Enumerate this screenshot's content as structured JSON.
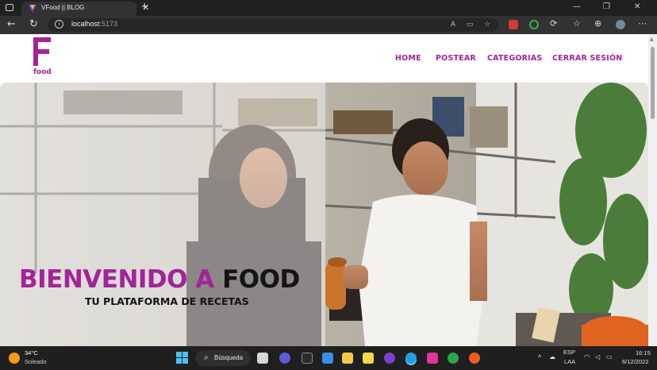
{
  "browser": {
    "tab_title": "VFood || BLOG",
    "close_label": "✕",
    "new_tab_label": "+",
    "address_host": "localhost",
    "address_port": ":5173",
    "window_controls": {
      "minimize": "—",
      "maximize": "❐",
      "close": "✕"
    },
    "reader_label": "A",
    "icons": [
      "back-icon",
      "refresh-icon",
      "info-icon",
      "read-aloud-icon",
      "immersive-reader-icon",
      "favorites-star-icon",
      "extension-icon",
      "collections-icon",
      "profile-icon",
      "more-icon"
    ]
  },
  "site": {
    "logo_word": "food",
    "nav": [
      "HOME",
      "POSTEAR",
      "CATEGORIAS",
      "CERRAR SESIÓN"
    ],
    "hero": {
      "title_part1": "BIENVENIDO A",
      "title_part2": "FOOD",
      "subtitle": "TU PLATAFORMA DE RECETAS"
    },
    "accent_color": "#a3249a"
  },
  "taskbar": {
    "weather_temp": "34°C",
    "weather_condition": "Soleado",
    "search_label": "Búsqueda",
    "language": "ESP",
    "keyboard_layout": "LAA",
    "time": "16:15",
    "date": "6/12/2022",
    "chevron": "^"
  }
}
